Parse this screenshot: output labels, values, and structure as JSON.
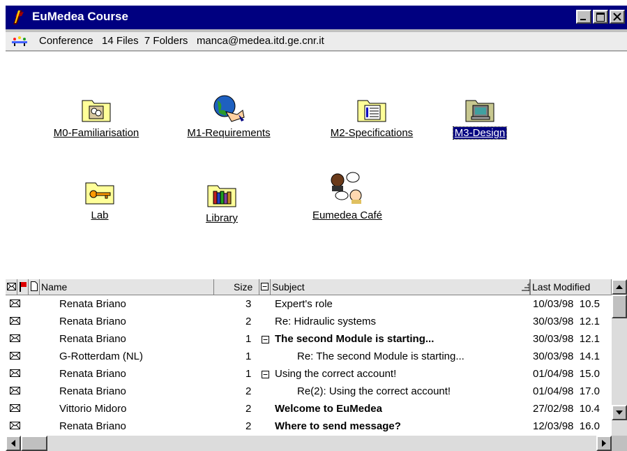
{
  "window": {
    "title": "EuMedea Course"
  },
  "infobar": {
    "text": "Conference   14 Files  7 Folders   manca@medea.itd.ge.cnr.it"
  },
  "icons": [
    {
      "label": "M0-Familiarisation",
      "icon": "folder-people-icon"
    },
    {
      "label": "M1-Requirements",
      "icon": "globe-hand-icon"
    },
    {
      "label": "M2-Specifications",
      "icon": "folder-document-icon"
    },
    {
      "label": "M3-Design",
      "icon": "folder-computer-icon",
      "selected": true
    },
    {
      "label": "Lab",
      "icon": "folder-key-icon"
    },
    {
      "label": "Library",
      "icon": "folder-books-icon"
    },
    {
      "label": "Eumedea Café",
      "icon": "chat-people-icon"
    }
  ],
  "columns": {
    "name": "Name",
    "size": "Size",
    "subject": "Subject",
    "modified": "Last Modified"
  },
  "rows": [
    {
      "name": "Renata Briano",
      "size": "3",
      "subject": "Expert's role",
      "modified": "10/03/98  10.5",
      "bold": false,
      "indent": 0,
      "expander": false
    },
    {
      "name": "Renata Briano",
      "size": "2",
      "subject": "Re: Hidraulic systems",
      "modified": "30/03/98  12.1",
      "bold": false,
      "indent": 0,
      "expander": false
    },
    {
      "name": "Renata Briano",
      "size": "1",
      "subject": "The second Module is starting...",
      "modified": "30/03/98  12.1",
      "bold": true,
      "indent": 0,
      "expander": true
    },
    {
      "name": "G-Rotterdam (NL)",
      "size": "1",
      "subject": "Re: The second Module is starting...",
      "modified": "30/03/98  14.1",
      "bold": false,
      "indent": 1,
      "expander": false
    },
    {
      "name": "Renata Briano",
      "size": "1",
      "subject": "Using the correct account!",
      "modified": "01/04/98  15.0",
      "bold": false,
      "indent": 0,
      "expander": true
    },
    {
      "name": "Renata Briano",
      "size": "2",
      "subject": "Re(2): Using the correct account!",
      "modified": "01/04/98  17.0",
      "bold": false,
      "indent": 1,
      "expander": false
    },
    {
      "name": "Vittorio Midoro",
      "size": "2",
      "subject": "Welcome to EuMedea",
      "modified": "27/02/98  10.4",
      "bold": true,
      "indent": 0,
      "expander": false
    },
    {
      "name": "Renata Briano",
      "size": "2",
      "subject": "Where to send message?",
      "modified": "12/03/98  16.0",
      "bold": true,
      "indent": 0,
      "expander": false
    }
  ]
}
